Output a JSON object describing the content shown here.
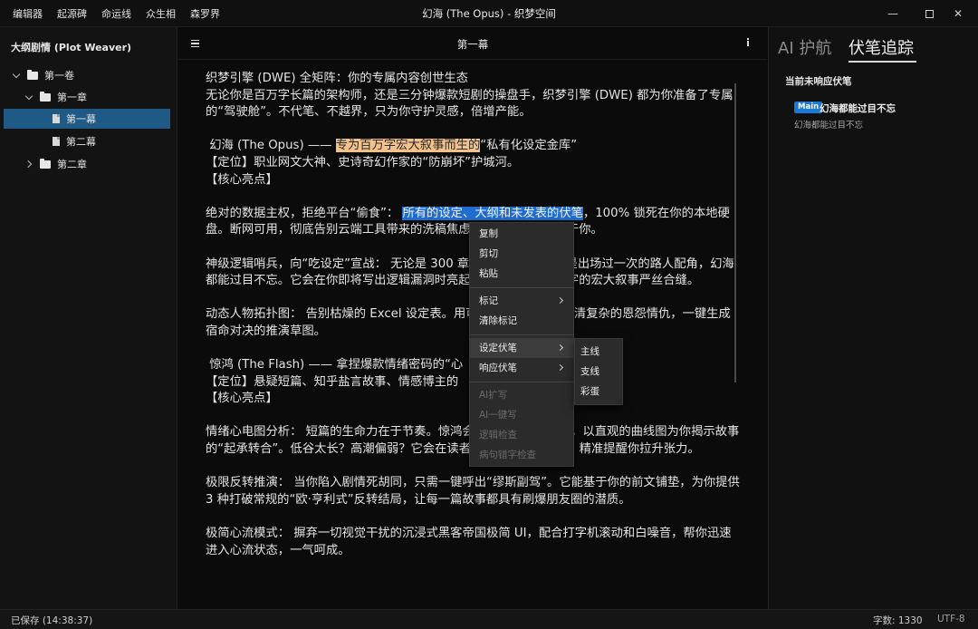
{
  "menu": [
    "编辑器",
    "起源碑",
    "命运线",
    "众生相",
    "森罗界"
  ],
  "window_title": "幻海 (The Opus) - 织梦空间",
  "window_controls": {
    "minimize": "—",
    "close": "✕"
  },
  "sidebar": {
    "title": "大纲剧情 (Plot Weaver)",
    "tree": [
      {
        "label": "第一卷",
        "level": 0,
        "type": "folder",
        "expanded": true
      },
      {
        "label": "第一章",
        "level": 1,
        "type": "folder",
        "expanded": true
      },
      {
        "label": "第一幕",
        "level": 2,
        "type": "doc",
        "selected": true
      },
      {
        "label": "第二幕",
        "level": 2,
        "type": "doc"
      },
      {
        "label": "第二章",
        "level": 0,
        "type": "folder",
        "expanded": false
      }
    ]
  },
  "editor": {
    "chapter_title": "第一幕",
    "paragraphs": [
      [
        {
          "t": "织梦引擎 (DWE) 全矩阵：你的专属内容创世生态"
        }
      ],
      [
        {
          "t": "无论你是百万字长篇的架构师，还是三分钟爆款短剧的操盘手，织梦引擎 (DWE) 都为你准备了专属的“驾驶舱”。不代笔、不越界，只为你守护灵感，倍增产能。"
        }
      ],
      [],
      [
        {
          "t": " 幻海 (The Opus) —— "
        },
        {
          "t": "专为百万字宏大叙事而生的",
          "hl": "orange"
        },
        {
          "t": "“私有化设定金库”"
        }
      ],
      [
        {
          "t": "【定位】职业网文大神、史诗奇幻作家的“防崩坏”护城河。"
        }
      ],
      [
        {
          "t": "【核心亮点】"
        }
      ],
      [],
      [
        {
          "t": "绝对的数据主权，拒绝平台“偷食”： "
        },
        {
          "t": "所有的设定、大纲和未发表的伏笔",
          "hl": "blue"
        },
        {
          "t": "，100% 锁死在你的本地硬盘。断网可用，彻底告别云端工具带来的洗稿焦虑。你的宇宙，只属于你。"
        }
      ],
      [],
      [
        {
          "t": "神级逻辑哨兵，向“吃设定”宣战： 无论是 300 章前埋下的暗线，还是出场过一次的路人配角，幻海都能过目不忘。它会在你即将写出逻辑漏洞时亮起红线，确保几百万字的宏大叙事严丝合缝。"
        }
      ],
      [],
      [
        {
          "t": "动态人物拓扑图： 告别枯燥的 Excel 设定表。用可视化的网状图谱理清复杂的恩怨情仇，一键生成宿命对决的推演草图。"
        }
      ],
      [],
      [
        {
          "t": " 惊鸿 (The Flash) —— 拿捏爆款情绪密码的“心"
        }
      ],
      [
        {
          "t": "【定位】悬疑短篇、知乎盐言故事、情感博主的"
        }
      ],
      [
        {
          "t": "【核心亮点】"
        }
      ],
      [],
      [
        {
          "t": "情绪心电图分析： 短篇的生命力在于节奏。惊鸿会实时分析你的文稿，以直观的曲线图为你揭示故事的“起承转合”。低谷太长？高潮偏弱？它会在读者即将划走的前一秒，精准提醒你拉升张力。"
        }
      ],
      [],
      [
        {
          "t": "极限反转推演： 当你陷入剧情死胡同，只需一键呼出“缪斯副驾”。它能基于你的前文铺垫，为你提供 3 种打破常规的“欧·亨利式”反转结局，让每一篇故事都具有刷爆朋友圈的潜质。"
        }
      ],
      [],
      [
        {
          "t": "极简心流模式： 摒弃一切视觉干扰的沉浸式黑客帝国极简 UI，配合打字机滚动和白噪音，帮你迅速进入心流状态，一气呵成。"
        }
      ]
    ]
  },
  "context_menu": {
    "items": [
      {
        "label": "复制",
        "enabled": true
      },
      {
        "label": "剪切",
        "enabled": true
      },
      {
        "label": "粘贴",
        "enabled": true
      },
      {
        "label": "标记",
        "enabled": true,
        "submenu": true
      },
      {
        "label": "清除标记",
        "enabled": true
      },
      {
        "label": "设定伏笔",
        "enabled": true,
        "submenu": true,
        "hover": true
      },
      {
        "label": "响应伏笔",
        "enabled": true,
        "submenu": true
      },
      {
        "label": "AI扩写",
        "enabled": false
      },
      {
        "label": "AI一键写",
        "enabled": false
      },
      {
        "label": "逻辑检查",
        "enabled": false
      },
      {
        "label": "病句错字检查",
        "enabled": false
      }
    ],
    "submenu": [
      "主线",
      "支线",
      "彩蛋"
    ]
  },
  "right_panel": {
    "tabs": [
      "AI 护航",
      "伏笔追踪"
    ],
    "active_tab": "伏笔追踪",
    "section_label": "当前未响应伏笔",
    "items": [
      {
        "badge": "Main",
        "title": "幻海都能过目不忘",
        "subtitle": "幻海都能过目不忘"
      }
    ]
  },
  "status": {
    "saved": "已保存 (14:38:37)",
    "word_count": "字数: 1330",
    "encoding": "UTF-8"
  },
  "colors": {
    "selection": "#1f5a86",
    "highlight_orange": "#f3c18c",
    "highlight_blue": "#1f6dd1",
    "badge": "#1a78d6"
  }
}
